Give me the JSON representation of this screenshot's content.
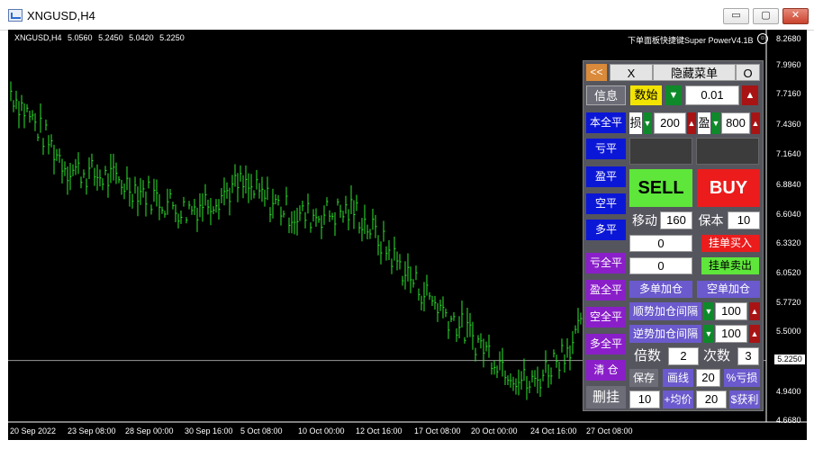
{
  "window": {
    "title": "XNGUSD,H4",
    "min": "▭",
    "max": "▢",
    "close": "✕"
  },
  "chart": {
    "symbol_line": [
      "XNGUSD,H4",
      "5.0560",
      "5.2450",
      "5.0420",
      "5.2250"
    ],
    "brand": "下单面板快捷键Super PowerV4.1B",
    "current_price": "5.2250",
    "y_ticks": [
      "8.2680",
      "7.9960",
      "7.7160",
      "7.4360",
      "7.1640",
      "6.8840",
      "6.6040",
      "6.3320",
      "6.0520",
      "5.7720",
      "5.5000",
      "5.2250",
      "4.9400",
      "4.6680"
    ],
    "x_ticks": [
      "20 Sep 2022",
      "23 Sep 08:00",
      "28 Sep 00:00",
      "30 Sep 16:00",
      "5 Oct 08:00",
      "10 Oct 00:00",
      "12 Oct 16:00",
      "17 Oct 08:00",
      "20 Oct 00:00",
      "24 Oct 16:00",
      "27 Oct 08:00"
    ]
  },
  "chart_data": {
    "type": "line",
    "title": "",
    "xlabel": "",
    "ylabel": "",
    "x": [
      "20 Sep 2022",
      "23 Sep 08:00",
      "28 Sep 00:00",
      "30 Sep 16:00",
      "5 Oct 08:00",
      "10 Oct 00:00",
      "12 Oct 16:00",
      "17 Oct 08:00",
      "20 Oct 00:00",
      "24 Oct 16:00",
      "27 Oct 08:00"
    ],
    "series": [
      {
        "values": [
          7.75,
          7.02,
          6.88,
          6.62,
          6.86,
          6.57,
          6.62,
          5.95,
          5.45,
          4.98,
          5.55
        ]
      }
    ],
    "ylim": [
      4.668,
      8.268
    ],
    "grid": false
  },
  "panel": {
    "collapse": "<<",
    "x": "X",
    "hide_menu": "隐藏菜单",
    "o": "O",
    "info": "信息",
    "mode": "数始",
    "lot": "0.01",
    "left_buttons": [
      "本全平",
      "亏平",
      "盈平",
      "空平",
      "多平",
      "亏全平",
      "盈全平",
      "空全平",
      "多全平",
      "清 仓",
      "删挂"
    ],
    "sl_label": "损",
    "sl_value": "200",
    "tp_label": "盈",
    "tp_value": "800",
    "sell": "SELL",
    "buy": "BUY",
    "move_label": "移动",
    "move_value": "160",
    "keep_label": "保本",
    "keep_value": "10",
    "pending1_value": "0",
    "pending_buy": "挂单买入",
    "pending2_value": "0",
    "pending_sell": "挂单卖出",
    "long_add": "多单加仓",
    "short_add": "空单加仓",
    "trend_add": "顺势加仓间隔",
    "trend_value": "100",
    "counter_add": "逆势加仓间隔",
    "counter_value": "100",
    "multiple_label": "倍数",
    "multiple_value": "2",
    "count_label": "次数",
    "count_value": "3",
    "save": "保存",
    "draw": "画线",
    "draw_value": "20",
    "loss_pct": "%亏损",
    "bottom_value1": "10",
    "avg_price": "+均价",
    "bottom_value2": "20",
    "profit": "$获利"
  }
}
